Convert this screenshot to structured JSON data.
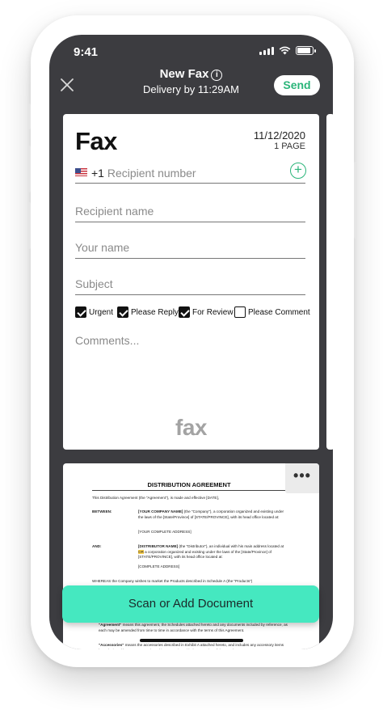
{
  "status_bar": {
    "time": "9:41"
  },
  "header": {
    "title": "New Fax",
    "subtitle": "Delivery by 11:29AM",
    "send_label": "Send"
  },
  "fax": {
    "heading": "Fax",
    "date": "11/12/2020",
    "pages": "1 PAGE",
    "country_code": "+1",
    "recipient_number_placeholder": "Recipient number",
    "recipient_name_placeholder": "Recipient name",
    "your_name_placeholder": "Your name",
    "subject_placeholder": "Subject",
    "options": [
      {
        "label": "Urgent",
        "checked": true
      },
      {
        "label": "Please Reply",
        "checked": true
      },
      {
        "label": "For Review",
        "checked": true
      },
      {
        "label": "Please Comment",
        "checked": false
      }
    ],
    "comments_placeholder": "Comments...",
    "logo_text": "fax"
  },
  "document": {
    "title": "DISTRIBUTION AGREEMENT",
    "intro": "This Distribution Agreement (the \"Agreement\"), is made and effective [DATE],",
    "between_label": "BETWEEN:",
    "between_text_bold": "[YOUR COMPANY NAME]",
    "between_text": " (the \"Company\"), a corporation organized and existing under the laws of the [State/Province] of [STATE/PROVINCE], with its head office located at:",
    "between_address": "[YOUR COMPLETE ADDRESS]",
    "and_label": "AND:",
    "and_text_bold": "[DISTRIBUTOR NAME]",
    "and_text_a": " (the \"Distributor\"), an individual with his main address located at ",
    "and_highlight": "OR",
    "and_text_b": " a corporation organized and existing under the laws of the [State/Province] of [STATE/PROVINCE], with its head office located at:",
    "and_address": "[COMPLETE ADDRESS]",
    "whereas": "WHEREAS the Company wishes to market the Products described in Schedule A (the \"Products\")",
    "agreement_def_bold": "\"Agreement\"",
    "agreement_def": " means this agreement, the Schedules attached hereto and any documents included by reference, as each may be amended from time to time in accordance with the terms of this Agreement.",
    "accessories_def_bold": "\"Accessories\"",
    "accessories_def": " means the accessories described in Exhibit A attached hereto, and includes any accessory items later designed by Company and used in connection with the operation of the Goods."
  },
  "scan_button_label": "Scan or Add Document"
}
